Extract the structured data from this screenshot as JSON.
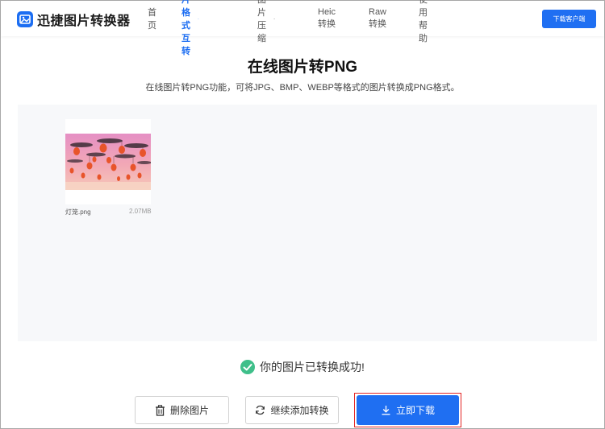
{
  "header": {
    "logo_text": "迅捷图片转换器",
    "nav": [
      {
        "label": "首页",
        "active": false,
        "dropdown": false
      },
      {
        "label": "图片格式互转",
        "active": true,
        "dropdown": true
      },
      {
        "label": "图片压缩",
        "active": false,
        "dropdown": true
      },
      {
        "label": "Heic转换",
        "active": false,
        "dropdown": false
      },
      {
        "label": "Raw转换",
        "active": false,
        "dropdown": false
      },
      {
        "label": "使用帮助",
        "active": false,
        "dropdown": false
      }
    ],
    "download_client_label": "下载客户端"
  },
  "page": {
    "title": "在线图片转PNG",
    "subtitle": "在线图片转PNG功能，可将JPG、BMP、WEBP等格式的图片转换成PNG格式。"
  },
  "file": {
    "name": "灯笼.png",
    "size": "2.07MB"
  },
  "status": {
    "message": "你的图片已转换成功!"
  },
  "actions": {
    "delete_label": "删除图片",
    "continue_label": "继续添加转换",
    "download_label": "立即下载"
  },
  "colors": {
    "accent": "#1f6ff2",
    "success": "#3fbf8a",
    "highlight_border": "#e32525",
    "work_area_bg": "#f7f8fa"
  },
  "icons": {
    "logo": "image-icon",
    "delete": "trash-icon",
    "continue": "refresh-icon",
    "download": "download-icon",
    "status": "check-circle-icon"
  }
}
